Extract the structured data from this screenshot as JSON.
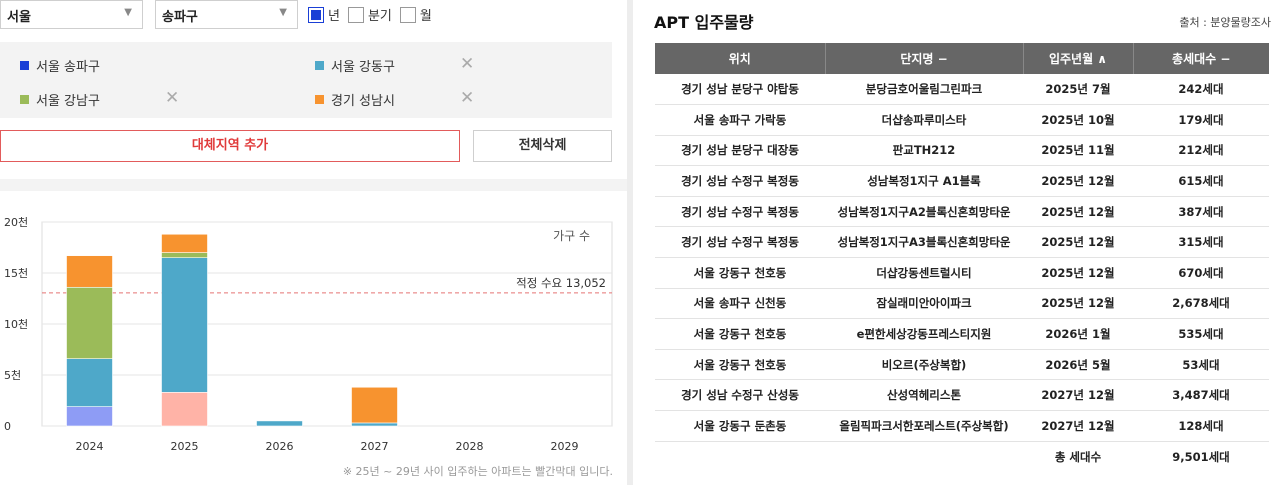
{
  "filters": {
    "region1": "서울",
    "region2": "송파구",
    "period_options": [
      {
        "label": "년",
        "checked": true
      },
      {
        "label": "분기",
        "checked": false
      },
      {
        "label": "월",
        "checked": false
      }
    ]
  },
  "regions": [
    {
      "label": "서울 송파구",
      "color": "#1a3fd6",
      "removable": false
    },
    {
      "label": "서울 강동구",
      "color": "#4ea8c9",
      "removable": true
    },
    {
      "label": "서울 강남구",
      "color": "#9bbb59",
      "removable": true
    },
    {
      "label": "경기 성남시",
      "color": "#f7932f",
      "removable": true
    }
  ],
  "buttons": {
    "add_region": "대체지역 추가",
    "delete_all": "전체삭제"
  },
  "chart_note": "※ 25년 ~ 29년 사이 입주하는 아파트는 빨간막대 입니다.",
  "chart_data": {
    "type": "bar",
    "categories": [
      "2024",
      "2025",
      "2026",
      "2027",
      "2028",
      "2029"
    ],
    "ylim": [
      0,
      20000
    ],
    "yticks": [
      "0",
      "5천",
      "10천",
      "15천",
      "20천"
    ],
    "ylabel": "가구 수",
    "reference_label": "적정 수요 13,052",
    "reference_value": 13052,
    "series": [
      {
        "name": "서울 송파구",
        "color_2024": "#8e9cf5",
        "color_future": "#ffb3a7",
        "values": [
          1900,
          3300,
          0,
          0,
          0,
          0
        ]
      },
      {
        "name": "서울 강동구",
        "color": "#4ea8c9",
        "values": [
          4700,
          13200,
          500,
          300,
          0,
          0
        ]
      },
      {
        "name": "서울 강남구",
        "color": "#9bbb59",
        "values": [
          7000,
          500,
          0,
          0,
          0,
          0
        ]
      },
      {
        "name": "경기 성남시",
        "color": "#f7932f",
        "values": [
          3100,
          1800,
          0,
          3500,
          0,
          0
        ]
      }
    ]
  },
  "table": {
    "title": "APT 입주물량",
    "source": "출처 : 분양물량조사",
    "headers": [
      "위치",
      "단지명 −",
      "입주년월 ∧",
      "총세대수 −"
    ],
    "rows": [
      [
        "경기 성남 분당구 야탑동",
        "분당금호어울림그린파크",
        "2025년 7월",
        "242세대"
      ],
      [
        "서울 송파구 가락동",
        "더샵송파루미스타",
        "2025년 10월",
        "179세대"
      ],
      [
        "경기 성남 분당구 대장동",
        "판교TH212",
        "2025년 11월",
        "212세대"
      ],
      [
        "경기 성남 수정구 복정동",
        "성남복정1지구 A1블록",
        "2025년 12월",
        "615세대"
      ],
      [
        "경기 성남 수정구 복정동",
        "성남복정1지구A2블록신혼희망타운",
        "2025년 12월",
        "387세대"
      ],
      [
        "경기 성남 수정구 복정동",
        "성남복정1지구A3블록신혼희망타운",
        "2025년 12월",
        "315세대"
      ],
      [
        "서울 강동구 천호동",
        "더샵강동센트럴시티",
        "2025년 12월",
        "670세대"
      ],
      [
        "서울 송파구 신천동",
        "잠실래미안아이파크",
        "2025년 12월",
        "2,678세대"
      ],
      [
        "서울 강동구 천호동",
        "e편한세상강동프레스티지원",
        "2026년 1월",
        "535세대"
      ],
      [
        "서울 강동구 천호동",
        "비오르(주상복합)",
        "2026년 5월",
        "53세대"
      ],
      [
        "경기 성남 수정구 산성동",
        "산성역헤리스톤",
        "2027년 12월",
        "3,487세대"
      ],
      [
        "서울 강동구 둔촌동",
        "올림픽파크서한포레스트(주상복합)",
        "2027년 12월",
        "128세대"
      ]
    ],
    "total_label": "총 세대수",
    "total_value": "9,501세대"
  }
}
